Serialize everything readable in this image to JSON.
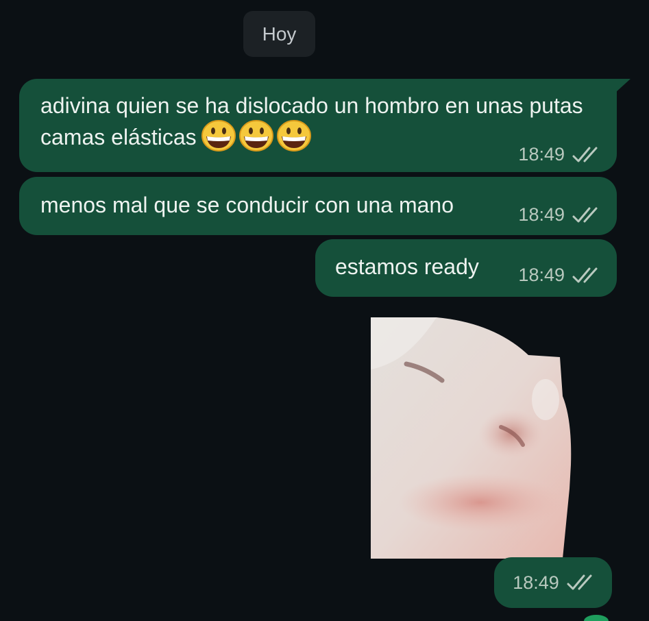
{
  "date_separator": "Hoy",
  "messages": [
    {
      "type": "text",
      "text": "adivina quien se ha dislocado un hombro en unas putas camas elásticas",
      "emojis": [
        "grinning-face",
        "grinning-face",
        "grinning-face"
      ],
      "time": "18:49",
      "status": "read"
    },
    {
      "type": "text",
      "text": "menos mal que se conducir con una mano",
      "time": "18:49",
      "status": "read"
    },
    {
      "type": "text",
      "text": "estamos ready",
      "time": "18:49",
      "status": "read"
    },
    {
      "type": "sticker",
      "sticker": "cat-face-sticker",
      "time": "18:49",
      "status": "read"
    }
  ],
  "colors": {
    "background": "#0b1014",
    "outgoing_bubble": "#15503a",
    "date_chip": "#1c2125",
    "ticks": "#b9c9bf"
  }
}
